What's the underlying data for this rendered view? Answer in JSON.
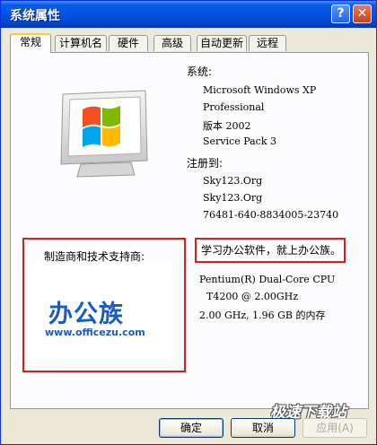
{
  "window": {
    "title": "系统属性"
  },
  "titlebar_buttons": {
    "help": "?",
    "close": "✕"
  },
  "tabs": [
    {
      "label": "常规",
      "active": true
    },
    {
      "label": "计算机名",
      "active": false
    },
    {
      "label": "硬件",
      "active": false
    },
    {
      "label": "高级",
      "active": false
    },
    {
      "label": "自动更新",
      "active": false
    },
    {
      "label": "远程",
      "active": false
    }
  ],
  "system": {
    "label": "系统:",
    "os_line1": "Microsoft Windows XP",
    "os_line2": "Professional",
    "version": "版本 2002",
    "service_pack": "Service Pack 3"
  },
  "registered": {
    "label": "注册到:",
    "user": "Sky123.Org",
    "org": "Sky123.Org",
    "product_id": "76481-640-8834005-23740"
  },
  "manufacturer": {
    "title": "制造商和技术支持商:",
    "logo_text": "办公族",
    "logo_url": "www.officezu.com"
  },
  "slogan": "学习办公软件，就上办公族。",
  "hardware": {
    "cpu_line1": "Pentium(R) Dual-Core CPU",
    "cpu_line2": "T4200  @ 2.00GHz",
    "spec": "2.00 GHz, 1.96 GB 的内存"
  },
  "buttons": {
    "ok": "确定",
    "cancel": "取消",
    "apply": "应用(A)"
  },
  "watermark": "极速下载站",
  "colors": {
    "highlight_border": "#d42020",
    "logo_blue": "#1a5bbf",
    "titlebar": "#0054e3"
  },
  "icons": {
    "monitor": "windows-monitor-icon"
  }
}
